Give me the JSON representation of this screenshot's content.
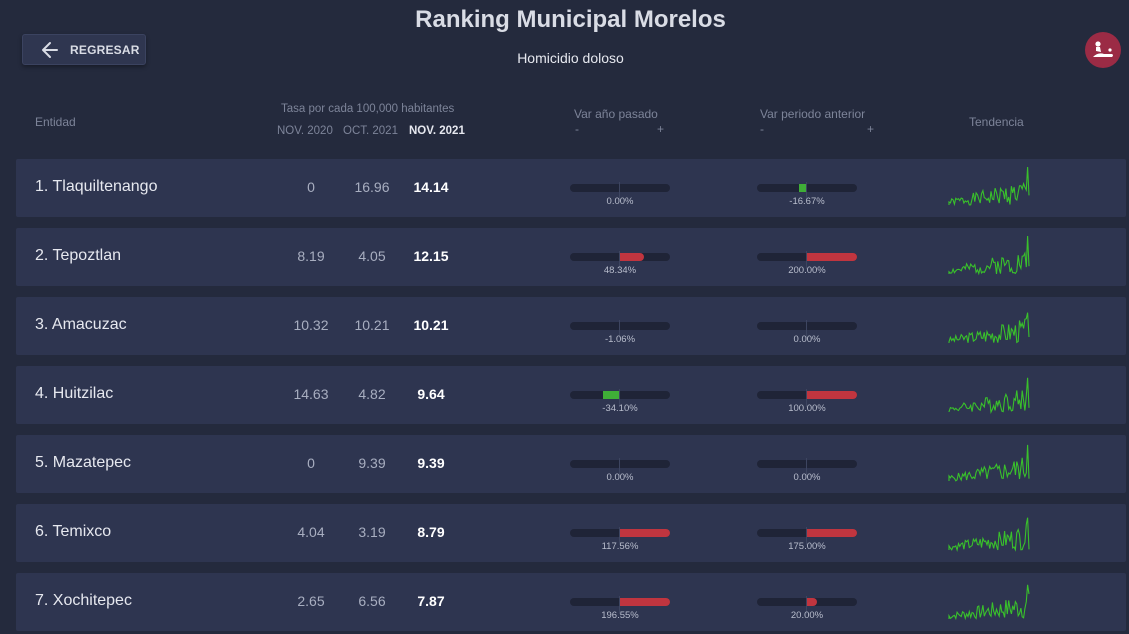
{
  "header": {
    "title": "Ranking Municipal Morelos",
    "subtitle": "Homicidio doloso",
    "back_label": "REGRESAR"
  },
  "columns": {
    "entity": "Entidad",
    "rate_group": "Tasa por cada 100,000 habitantes",
    "period_1": "NOV. 2020",
    "period_2": "OCT. 2021",
    "period_3": "NOV. 2021",
    "var_year": "Var año pasado",
    "var_period": "Var periodo anterior",
    "minus": "-",
    "plus": "+",
    "trend": "Tendencia"
  },
  "colors": {
    "increase": "#c0353f",
    "decrease": "#3fae37",
    "sparkline": "#39c12b",
    "avatar": "#9b2b45"
  },
  "rows": [
    {
      "name": "1. Tlaquiltenango",
      "v1": "0",
      "v2": "16.96",
      "v3": "14.14",
      "var_year": 0,
      "var_year_label": "0.00%",
      "var_period": -16.67,
      "var_period_label": "-16.67%"
    },
    {
      "name": "2. Tepoztlan",
      "v1": "8.19",
      "v2": "4.05",
      "v3": "12.15",
      "var_year": 48.34,
      "var_year_label": "48.34%",
      "var_period": 200,
      "var_period_label": "200.00%"
    },
    {
      "name": "3. Amacuzac",
      "v1": "10.32",
      "v2": "10.21",
      "v3": "10.21",
      "var_year": -1.06,
      "var_year_label": "-1.06%",
      "var_period": 0,
      "var_period_label": "0.00%"
    },
    {
      "name": "4. Huitzilac",
      "v1": "14.63",
      "v2": "4.82",
      "v3": "9.64",
      "var_year": -34.1,
      "var_year_label": "-34.10%",
      "var_period": 100,
      "var_period_label": "100.00%"
    },
    {
      "name": "5. Mazatepec",
      "v1": "0",
      "v2": "9.39",
      "v3": "9.39",
      "var_year": 0,
      "var_year_label": "0.00%",
      "var_period": 0,
      "var_period_label": "0.00%"
    },
    {
      "name": "6. Temixco",
      "v1": "4.04",
      "v2": "3.19",
      "v3": "8.79",
      "var_year": 117.56,
      "var_year_label": "117.56%",
      "var_period": 175,
      "var_period_label": "175.00%"
    },
    {
      "name": "7. Xochitepec",
      "v1": "2.65",
      "v2": "6.56",
      "v3": "7.87",
      "var_year": 196.55,
      "var_year_label": "196.55%",
      "var_period": 20,
      "var_period_label": "20.00%"
    }
  ]
}
